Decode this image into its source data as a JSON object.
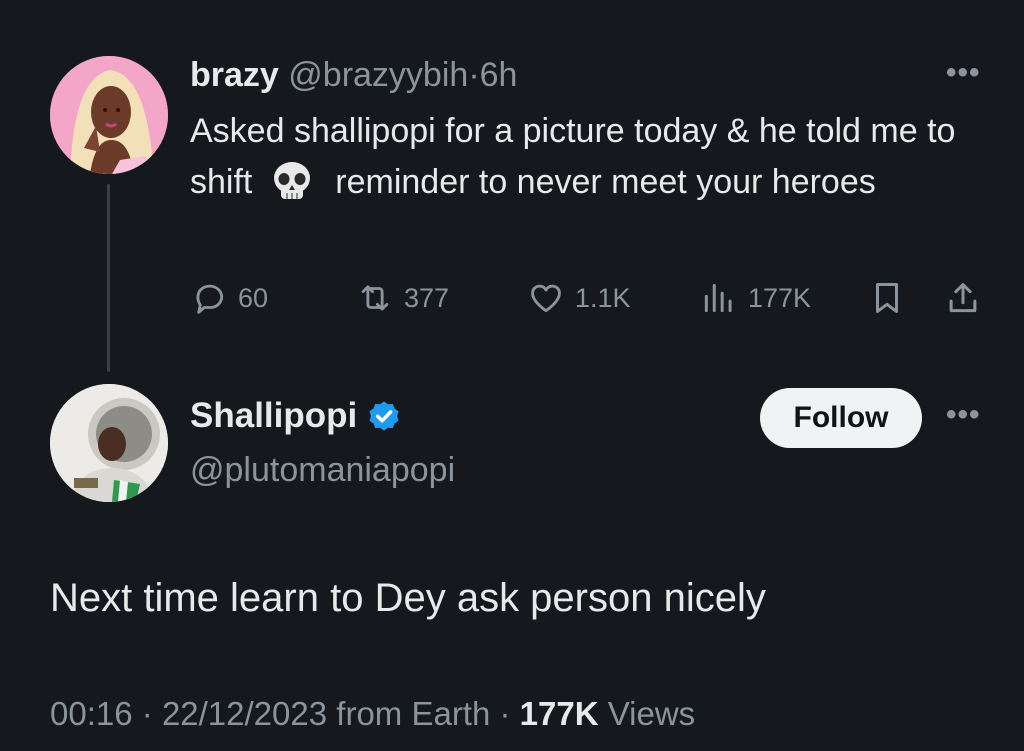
{
  "tweet": {
    "author_name": "brazy",
    "author_handle": "@brazyybih",
    "separator": "·",
    "age": "6h",
    "text_part1": "Asked shallipopi for a picture today & he told me to shift",
    "emoji_icon": "skull-icon",
    "text_part2": "reminder to never meet your heroes",
    "stats": {
      "replies": "60",
      "reposts": "377",
      "likes": "1.1K",
      "views": "177K"
    }
  },
  "reply": {
    "author_name": "Shallipopi",
    "author_handle": "@plutomaniapopi",
    "follow_label": "Follow",
    "text": "Next time learn to Dey ask person nicely",
    "time": "00:16",
    "date": "22/12/2023",
    "source": "from Earth",
    "views_count": "177K",
    "views_label": "Views"
  },
  "colors": {
    "background": "#15181d",
    "text": "#e7e9ea",
    "muted": "#8b949c",
    "verified": "#1d9bf0",
    "follow_bg": "#eff3f4"
  }
}
